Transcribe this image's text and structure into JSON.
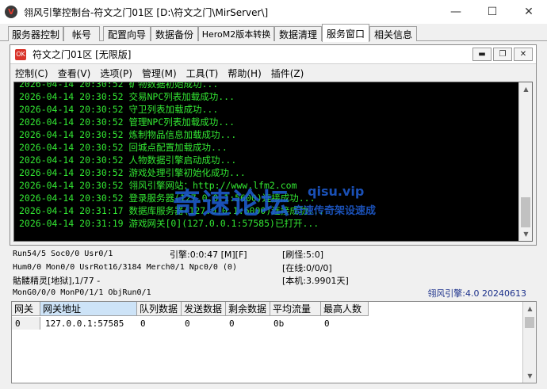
{
  "window": {
    "title": "翎风引擎控制台-符文之门01区 [D:\\符文之门\\MirServer\\]",
    "minimize": "—",
    "maximize": "☐",
    "close": "✕"
  },
  "tabs": [
    {
      "label": "服务器控制",
      "active": false
    },
    {
      "label": "帐号",
      "active": false
    },
    {
      "label": "配置向导",
      "active": false
    },
    {
      "label": "数据备份",
      "active": false
    },
    {
      "label": "HeroM2版本转换",
      "active": false
    },
    {
      "label": "数据清理",
      "active": false
    },
    {
      "label": "服务窗口",
      "active": true
    },
    {
      "label": "相关信息",
      "active": false
    }
  ],
  "inner_window": {
    "icon_text": "OK",
    "title": "符文之门01区 [无限版]",
    "btn_minimize": "▬",
    "btn_restore": "❐",
    "btn_close": "✕",
    "menus": [
      "控制(C)",
      "查看(V)",
      "选项(P)",
      "管理(M)",
      "工具(T)",
      "帮助(H)",
      "插件(Z)"
    ]
  },
  "console": {
    "lines": [
      "2026-04-14 20:30:52 矿物数据初始成功...",
      "2026-04-14 20:30:52 交易NPC列表加载成功...",
      "2026-04-14 20:30:52 守卫列表加载成功...",
      "2026-04-14 20:30:52 管理NPC列表加载成功...",
      "2026-04-14 20:30:52 炼制物品信息加载成功...",
      "2026-04-14 20:30:52 回城点配置加载成功...",
      "2026-04-14 20:30:52 人物数据引擎启动成功...",
      "2026-04-14 20:30:52 游戏处理引擎初始化成功...",
      "2026-04-14 20:30:52 翎风引擎网站：http://www.lfm2.com",
      "2026-04-14 20:30:52 登录服务器(127.0.0.1:5600)连接成功...",
      "2026-04-14 20:31:17 数据库服务器(127.0.0.1:6000)连接成功...",
      "2026-04-14 20:31:19 游戏网关[0](127.0.0.1:57585)已打开..."
    ]
  },
  "watermark": {
    "big": "奇速论坛",
    "url": "qisu.vip",
    "sub": "奇速传奇架设速成"
  },
  "status": {
    "run": "Run54/5 Soc0/0 Usr0/1",
    "engine": "引擎:0:0:47 [M][F]",
    "refresh": "[刷怪:5:0]",
    "hum": "Hum0/0 Mon0/0 UsrRot16/3184 Merch0/1 Npc0/0 (0)",
    "online": "[在线:0/0/0]",
    "monster": "骷髅精灵[地狱],1/77 -",
    "local": "[本机:3.9901天]",
    "mon_gen": "MonG0/0/0 MonP0/1/1 ObjRun0/1",
    "version": "翎风引擎:4.0 20240613"
  },
  "gate_table": {
    "columns": [
      "网关",
      "网关地址",
      "队列数据",
      "发送数据",
      "剩余数据",
      "平均流量",
      "最高人数"
    ],
    "rows": [
      [
        "0",
        "127.0.0.1:57585",
        "0",
        "0",
        "0",
        "0b",
        "0"
      ]
    ]
  }
}
